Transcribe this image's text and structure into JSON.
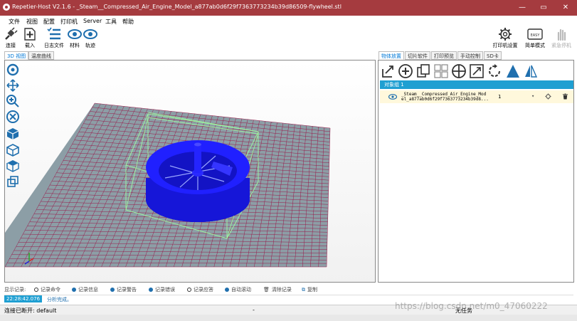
{
  "window": {
    "title": "Repetier-Host V2.1.6 - _Steam__Compressed_Air_Engine_Model_a877ab0d6f29f7363773234b39d86509-flywheel.stl",
    "minimize": "—",
    "maximize": "▭",
    "close": "✕",
    "accent": "#a53b3f"
  },
  "menu": [
    "文件",
    "视图",
    "配置",
    "打印机",
    "Server",
    "工具",
    "帮助"
  ],
  "toolbar": {
    "connect": "连接",
    "load": "载入",
    "log": "日志文件",
    "material": "材料",
    "track": "轨迹",
    "printer_settings": "打印机设置",
    "easy_badge": "EASY",
    "easy_mode": "简单模式",
    "emergency": "紧急停机"
  },
  "left_tabs": [
    "3D 视图",
    "温度曲线"
  ],
  "right_tabs": [
    "物体放置",
    "切片软件",
    "打印预览",
    "手动控制",
    "SD卡"
  ],
  "object_panel": {
    "group_label": "对象组 1",
    "object_name_line1": "_Steam__Compressed_Air_Engine_Mod",
    "object_name_line2": "el_a877ab0d6f29f7363773234b39d8...",
    "copies": "1",
    "dropdown": "▾"
  },
  "log": {
    "label": "显示记录:",
    "options": [
      {
        "text": "记录命令",
        "state": "off"
      },
      {
        "text": "记录信息",
        "state": "on"
      },
      {
        "text": "记录警告",
        "state": "on"
      },
      {
        "text": "记录错误",
        "state": "on"
      },
      {
        "text": "记录应答",
        "state": "off"
      },
      {
        "text": "自动滚动",
        "state": "on"
      },
      {
        "text": "清除记录",
        "state": "trash"
      },
      {
        "text": "复制",
        "state": "copy"
      }
    ],
    "timestamp": "22:28:42.076",
    "message": "分析完成。"
  },
  "status": {
    "connection": "连接已断开: default",
    "middle": "-",
    "right": "无任务",
    "watermark": "https://blog.csdn.net/m0_47060222"
  },
  "colors": {
    "model": "#1414e6",
    "bed": "#8c9ea6",
    "grid": "#9a1a4a",
    "bbox": "#9cf0a0",
    "icon": "#1f6fae",
    "group": "#1f9fd2"
  }
}
